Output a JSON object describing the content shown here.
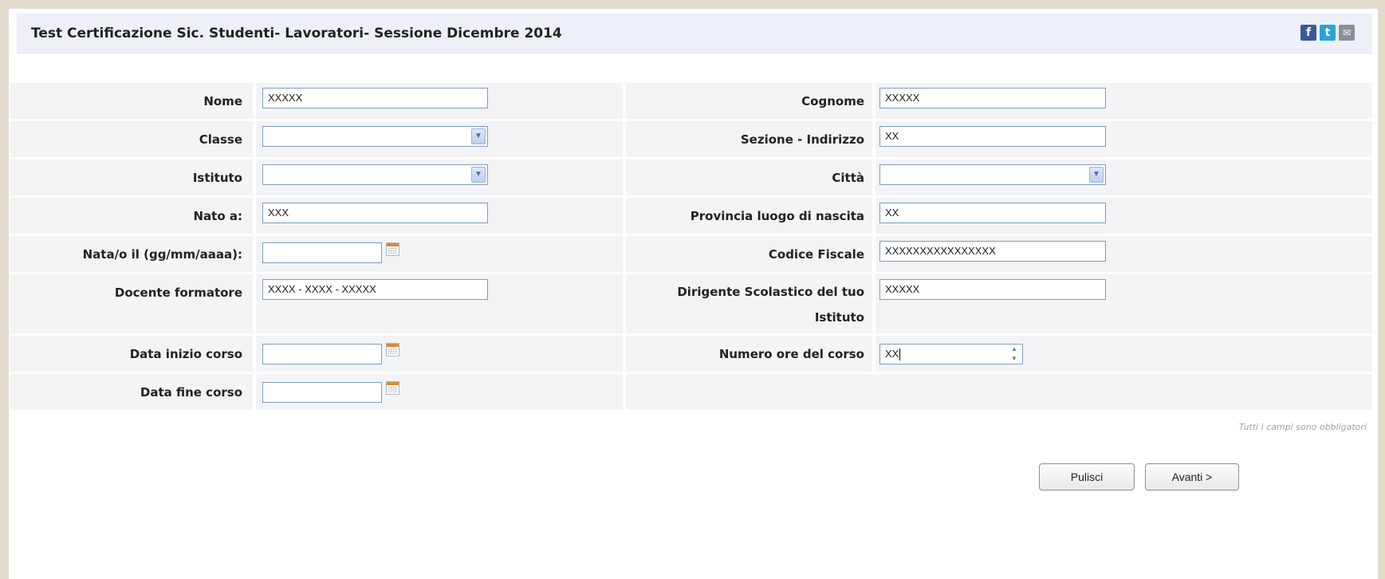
{
  "header": {
    "title": "Test Certificazione Sic. Studenti- Lavoratori- Sessione Dicembre 2014",
    "share": {
      "facebook": "f",
      "twitter": "t",
      "mail": "✉"
    }
  },
  "form": {
    "nome": {
      "label": "Nome",
      "value": "XXXXX"
    },
    "cognome": {
      "label": "Cognome",
      "value": "XXXXX"
    },
    "classe": {
      "label": "Classe",
      "value": ""
    },
    "sezione": {
      "label": "Sezione - Indirizzo",
      "value": "XX"
    },
    "istituto": {
      "label": "Istituto",
      "value": ""
    },
    "citta": {
      "label": "Città",
      "value": ""
    },
    "nato_a": {
      "label": "Nato a:",
      "value": "XXX"
    },
    "provincia": {
      "label": "Provincia luogo di nascita",
      "value": "XX"
    },
    "nata_il": {
      "label": "Nata/o il (gg/mm/aaaa):",
      "value": ""
    },
    "codice_fiscale": {
      "label": "Codice Fiscale",
      "value": "XXXXXXXXXXXXXXXX"
    },
    "docente": {
      "label": "Docente formatore",
      "value": "XXXX - XXXX - XXXXX"
    },
    "dirigente": {
      "label": "Dirigente Scolastico del tuo Istituto",
      "value": "XXXXX"
    },
    "data_inizio": {
      "label": "Data inizio corso",
      "value": ""
    },
    "numero_ore": {
      "label": "Numero ore del corso",
      "value": "XX"
    },
    "data_fine": {
      "label": "Data fine corso",
      "value": ""
    }
  },
  "note": "Tutti i campi sono obbligatori",
  "buttons": {
    "clear": "Pulisci",
    "next": "Avanti >"
  },
  "icons": {
    "select_arrow": "chevron-down-icon",
    "calendar": "calendar-icon",
    "spinner": "spinner-icon"
  }
}
